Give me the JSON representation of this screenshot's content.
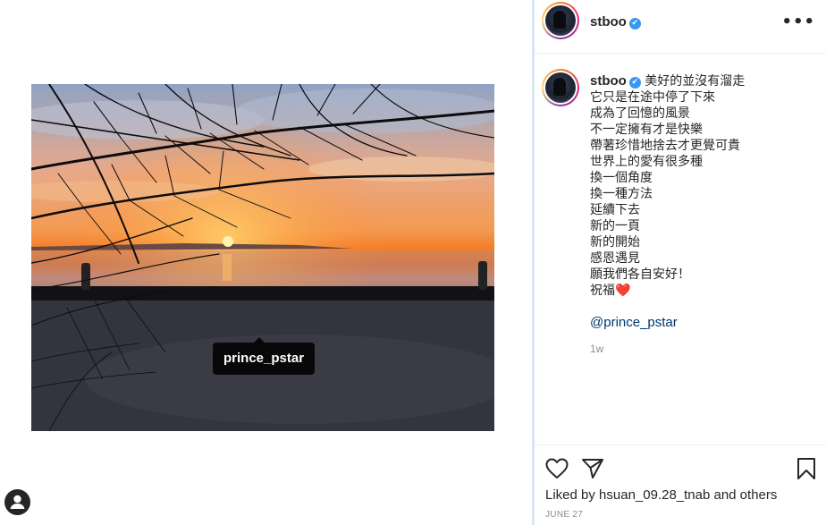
{
  "post": {
    "photo_tag": "prince_pstar"
  },
  "header": {
    "username": "stboo",
    "verified_mark": "✔",
    "more_label": "•••"
  },
  "caption": {
    "username": "stboo",
    "lines": [
      "美好的並沒有溜走",
      "它只是在途中停了下來",
      "成為了回憶的風景",
      "不一定擁有才是快樂",
      "帶著珍惜地捨去才更覺可貴",
      "世界上的愛有很多種",
      "換一個角度",
      "換一種方法",
      "延續下去",
      "新的一頁",
      "新的開始",
      "感恩遇見",
      "願我們各自安好！",
      "祝福❤️"
    ],
    "mention": "@prince_pstar",
    "time_ago": "1w"
  },
  "footer": {
    "likes_text": "Liked by hsuan_09.28_tnab and others",
    "date": "JUNE 27"
  },
  "icons": {
    "like": "heart-icon",
    "share": "paper-plane-icon",
    "save": "bookmark-icon",
    "tags": "user-tag-icon",
    "more": "more-options-icon",
    "verified": "verified-badge-icon"
  },
  "colors": {
    "verified": "#3897f0",
    "mention": "#00376b",
    "muted": "#8e8e8e",
    "divider": "#d9e6f2"
  }
}
